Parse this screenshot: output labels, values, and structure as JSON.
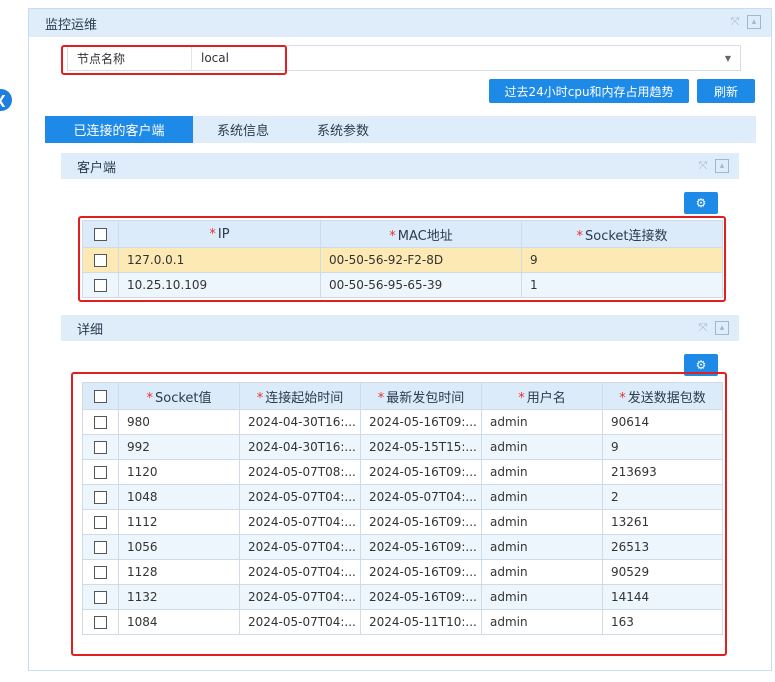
{
  "panel": {
    "title": "监控运维"
  },
  "node": {
    "label": "节点名称",
    "value": "local"
  },
  "buttons": {
    "trend": "过去24小时cpu和内存占用趋势",
    "refresh": "刷新"
  },
  "tabs": [
    "已连接的客户端",
    "系统信息",
    "系统参数"
  ],
  "clients": {
    "title": "客户端",
    "columns": [
      "IP",
      "MAC地址",
      "Socket连接数"
    ],
    "rows": [
      [
        "127.0.0.1",
        "00-50-56-92-F2-8D",
        "9"
      ],
      [
        "10.25.10.109",
        "00-50-56-95-65-39",
        "1"
      ]
    ]
  },
  "details": {
    "title": "详细",
    "columns": [
      "Socket值",
      "连接起始时间",
      "最新发包时间",
      "用户名",
      "发送数据包数"
    ],
    "rows": [
      [
        "980",
        "2024-04-30T16:...",
        "2024-05-16T09:...",
        "admin",
        "90614"
      ],
      [
        "992",
        "2024-04-30T16:...",
        "2024-05-15T15:...",
        "admin",
        "9"
      ],
      [
        "1120",
        "2024-05-07T08:...",
        "2024-05-16T09:...",
        "admin",
        "213693"
      ],
      [
        "1048",
        "2024-05-07T04:...",
        "2024-05-07T04:...",
        "admin",
        "2"
      ],
      [
        "1112",
        "2024-05-07T04:...",
        "2024-05-16T09:...",
        "admin",
        "13261"
      ],
      [
        "1056",
        "2024-05-07T04:...",
        "2024-05-16T09:...",
        "admin",
        "26513"
      ],
      [
        "1128",
        "2024-05-07T04:...",
        "2024-05-16T09:...",
        "admin",
        "90529"
      ],
      [
        "1132",
        "2024-05-07T04:...",
        "2024-05-16T09:...",
        "admin",
        "14144"
      ],
      [
        "1084",
        "2024-05-07T04:...",
        "2024-05-11T10:...",
        "admin",
        "163"
      ]
    ]
  },
  "colors": {
    "accent": "#1e8ae8",
    "header_bg": "#dfedfa",
    "highlight": "#fde9b3",
    "annotation": "#e02020"
  },
  "icons": {
    "collapse": "chevron-left-icon",
    "expand": "expand-icon",
    "minimize": "minimize-icon",
    "settings": "gear-icon"
  }
}
